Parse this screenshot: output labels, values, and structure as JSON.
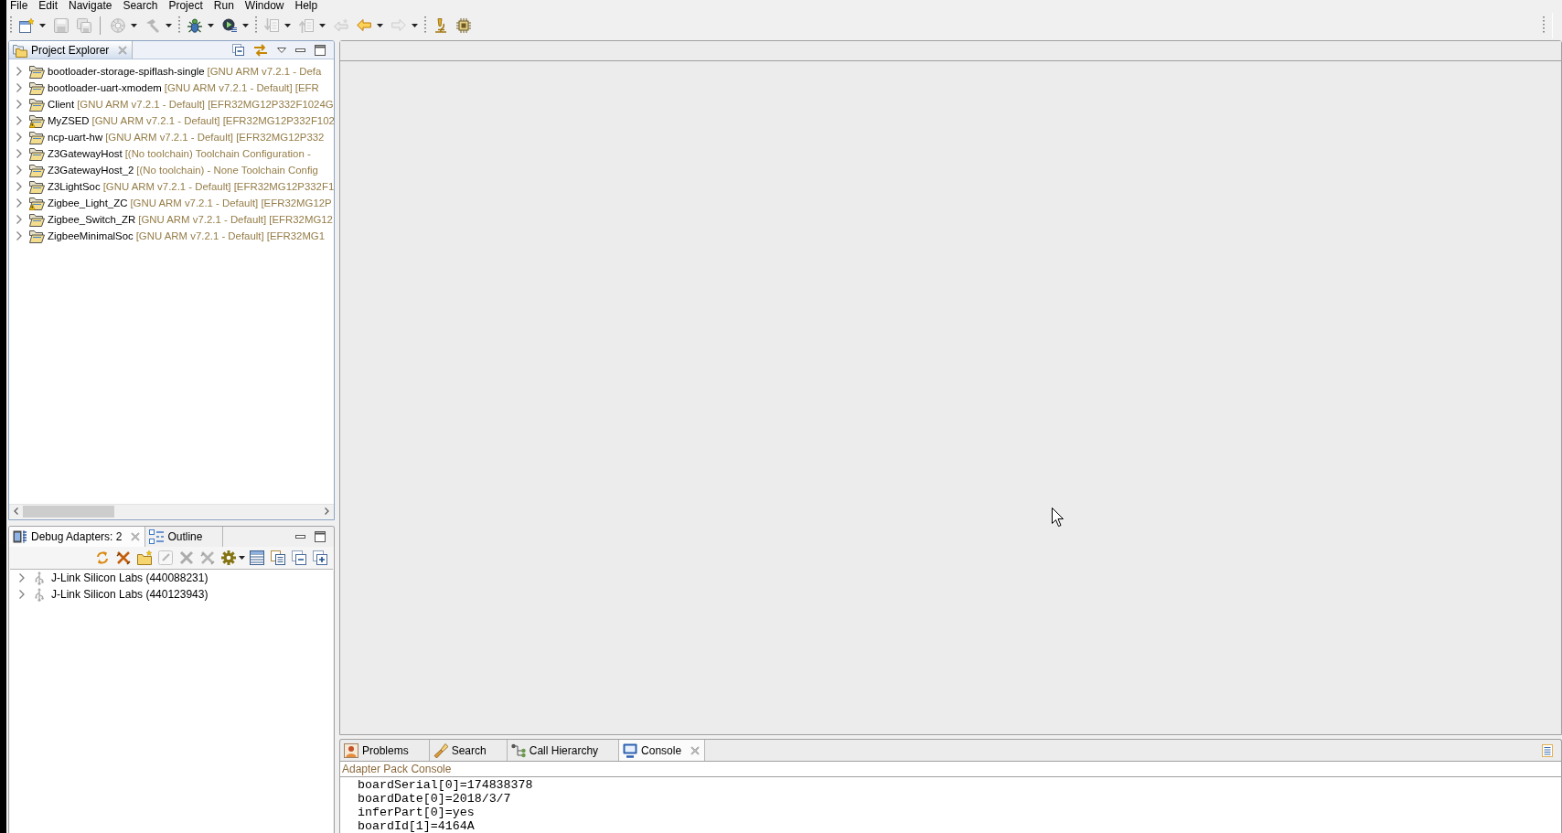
{
  "menu": [
    "File",
    "Edit",
    "Navigate",
    "Search",
    "Project",
    "Run",
    "Window",
    "Help"
  ],
  "toolbar": [
    {
      "kind": "grip"
    },
    {
      "kind": "button",
      "disabled": false,
      "dropdown": true
    },
    {
      "kind": "button",
      "disabled": true,
      "dropdown": false
    },
    {
      "kind": "button",
      "disabled": true,
      "dropdown": false
    },
    {
      "kind": "separator"
    },
    {
      "kind": "button",
      "disabled": true,
      "dropdown": true
    },
    {
      "kind": "button",
      "disabled": true,
      "dropdown": true
    },
    {
      "kind": "grip"
    },
    {
      "kind": "button",
      "disabled": false,
      "dropdown": true
    },
    {
      "kind": "button",
      "disabled": false,
      "dropdown": true
    },
    {
      "kind": "grip"
    },
    {
      "kind": "button",
      "disabled": true,
      "dropdown": true
    },
    {
      "kind": "button",
      "disabled": true,
      "dropdown": true
    },
    {
      "kind": "button",
      "disabled": true,
      "dropdown": false
    },
    {
      "kind": "button",
      "disabled": false,
      "dropdown": true
    },
    {
      "kind": "button",
      "disabled": true,
      "dropdown": true
    },
    {
      "kind": "grip"
    },
    {
      "kind": "button",
      "disabled": false,
      "dropdown": false
    },
    {
      "kind": "button",
      "disabled": false,
      "dropdown": false
    }
  ],
  "project_explorer": {
    "active": true,
    "tabs": [
      {
        "label": "Project Explorer",
        "selected": true
      }
    ],
    "projects": [
      {
        "name": "bootloader-storage-spiflash-single",
        "details": "[GNU ARM v7.2.1 - Defa",
        "warning": false,
        "expanded": false
      },
      {
        "name": "bootloader-uart-xmodem",
        "details": "[GNU ARM v7.2.1 - Default] [EFR",
        "warning": false,
        "expanded": false
      },
      {
        "name": "Client",
        "details": "[GNU ARM v7.2.1 - Default] [EFR32MG12P332F1024G",
        "warning": false,
        "expanded": false
      },
      {
        "name": "MyZSED",
        "details": "[GNU ARM v7.2.1 - Default] [EFR32MG12P332F102",
        "warning": true,
        "expanded": false
      },
      {
        "name": "ncp-uart-hw",
        "details": "[GNU ARM v7.2.1 - Default] [EFR32MG12P332",
        "warning": false,
        "expanded": false
      },
      {
        "name": "Z3GatewayHost",
        "details": "[(No toolchain) Toolchain Configuration -",
        "warning": false,
        "expanded": false
      },
      {
        "name": "Z3GatewayHost_2",
        "details": "[(No toolchain) - None Toolchain Config",
        "warning": false,
        "expanded": false
      },
      {
        "name": "Z3LightSoc",
        "details": "[GNU ARM v7.2.1 - Default] [EFR32MG12P332F1",
        "warning": false,
        "expanded": false
      },
      {
        "name": "Zigbee_Light_ZC",
        "details": "[GNU ARM v7.2.1 - Default] [EFR32MG12P",
        "warning": true,
        "expanded": false
      },
      {
        "name": "Zigbee_Switch_ZR",
        "details": "[GNU ARM v7.2.1 - Default] [EFR32MG12",
        "warning": false,
        "expanded": false
      },
      {
        "name": "ZigbeeMinimalSoc",
        "details": "[GNU ARM v7.2.1 - Default] [EFR32MG1",
        "warning": false,
        "expanded": false
      }
    ]
  },
  "debug_adapters": {
    "active": false,
    "tabs": [
      {
        "label": "Debug Adapters: 2",
        "selected": true
      },
      {
        "label": "Outline",
        "selected": false
      }
    ],
    "toolbar": [
      {
        "disabled": false,
        "dropdown": false
      },
      {
        "disabled": false,
        "dropdown": false
      },
      {
        "disabled": false,
        "dropdown": false
      },
      {
        "disabled": true,
        "dropdown": false
      },
      {
        "disabled": true,
        "dropdown": false
      },
      {
        "disabled": true,
        "dropdown": false
      },
      {
        "disabled": false,
        "dropdown": true
      },
      {
        "disabled": false,
        "dropdown": false
      },
      {
        "disabled": false,
        "dropdown": false
      },
      {
        "disabled": false,
        "dropdown": false
      },
      {
        "disabled": false,
        "dropdown": false
      }
    ],
    "adapters": [
      {
        "label": "J-Link Silicon Labs (440088231)",
        "expanded": false
      },
      {
        "label": "J-Link Silicon Labs (440123943)",
        "expanded": false
      }
    ]
  },
  "bottom_panel": {
    "active": false,
    "tabs": [
      {
        "label": "Problems",
        "selected": false
      },
      {
        "label": "Search",
        "selected": false
      },
      {
        "label": "Call Hierarchy",
        "selected": false
      },
      {
        "label": "Console",
        "selected": true
      }
    ],
    "console": {
      "title": "Adapter Pack Console",
      "lines": [
        "boardSerial[0]=174838378",
        "boardDate[0]=2018/3/7",
        "inferPart[0]=yes",
        "boardId[1]=4164A"
      ]
    }
  }
}
